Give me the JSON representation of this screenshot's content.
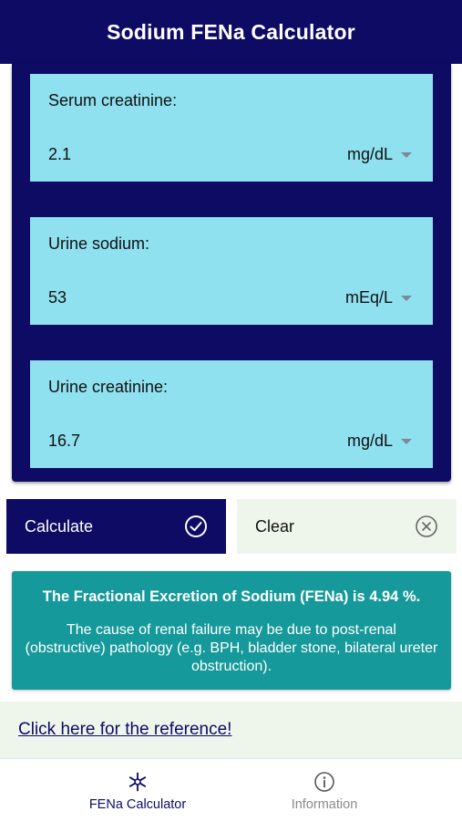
{
  "header": {
    "title": "Sodium FENa Calculator"
  },
  "fields": [
    {
      "label": "Serum creatinine:",
      "value": "2.1",
      "unit": "mg/dL"
    },
    {
      "label": "Urine sodium:",
      "value": "53",
      "unit": "mEq/L"
    },
    {
      "label": "Urine creatinine:",
      "value": "16.7",
      "unit": "mg/dL"
    }
  ],
  "actions": {
    "calculate_label": "Calculate",
    "clear_label": "Clear"
  },
  "result": {
    "title": "The Fractional Excretion of Sodium (FENa) is 4.94 %.",
    "text": "The cause of renal failure may be due to post-renal (obstructive) pathology (e.g. BPH, bladder stone, bilateral ureter obstruction)."
  },
  "reference": {
    "link_text": "Click here for the reference!"
  },
  "tabs": [
    {
      "label": "FENa Calculator",
      "icon": "asterisk-icon",
      "active": true
    },
    {
      "label": "Information",
      "icon": "info-icon",
      "active": false
    }
  ],
  "colors": {
    "primary": "#0d0b63",
    "field_bg": "#8fe1ef",
    "result_bg": "#16999a",
    "light_bg": "#eef6ec"
  }
}
